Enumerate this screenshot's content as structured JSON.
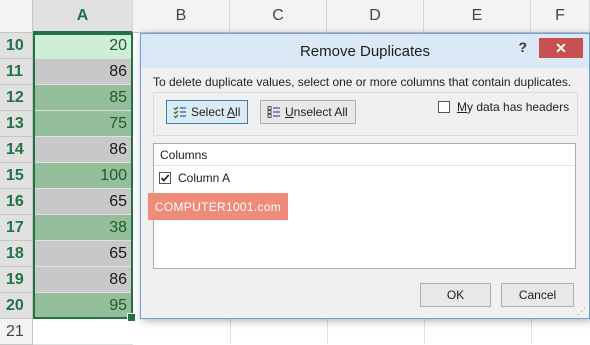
{
  "spreadsheet": {
    "columns": [
      "A",
      "B",
      "C",
      "D",
      "E",
      "F"
    ],
    "rows": [
      {
        "num": "10",
        "value": "20"
      },
      {
        "num": "11",
        "value": "86"
      },
      {
        "num": "12",
        "value": "85"
      },
      {
        "num": "13",
        "value": "75"
      },
      {
        "num": "14",
        "value": "86"
      },
      {
        "num": "15",
        "value": "100"
      },
      {
        "num": "16",
        "value": "65"
      },
      {
        "num": "17",
        "value": "38"
      },
      {
        "num": "18",
        "value": "65"
      },
      {
        "num": "19",
        "value": "86"
      },
      {
        "num": "20",
        "value": "95"
      },
      {
        "num": "21",
        "value": ""
      }
    ],
    "highlight_colors": {
      "dup": "#94bf9a",
      "uniq": "#c8c8c8",
      "first": "#cfeed6",
      "accent": "#217346"
    }
  },
  "dialog": {
    "title": "Remove Duplicates",
    "help": "?",
    "close": "✕",
    "instruction": "To delete duplicate values, select one or more columns that contain duplicates.",
    "select_all": "Select All",
    "unselect_all": "Unselect All",
    "my_data_has_headers": "My data has headers",
    "columns_header": "Columns",
    "column_item": "Column A",
    "column_item_checked": true,
    "ok": "OK",
    "cancel": "Cancel"
  },
  "watermark": "COMPUTER1001.com"
}
